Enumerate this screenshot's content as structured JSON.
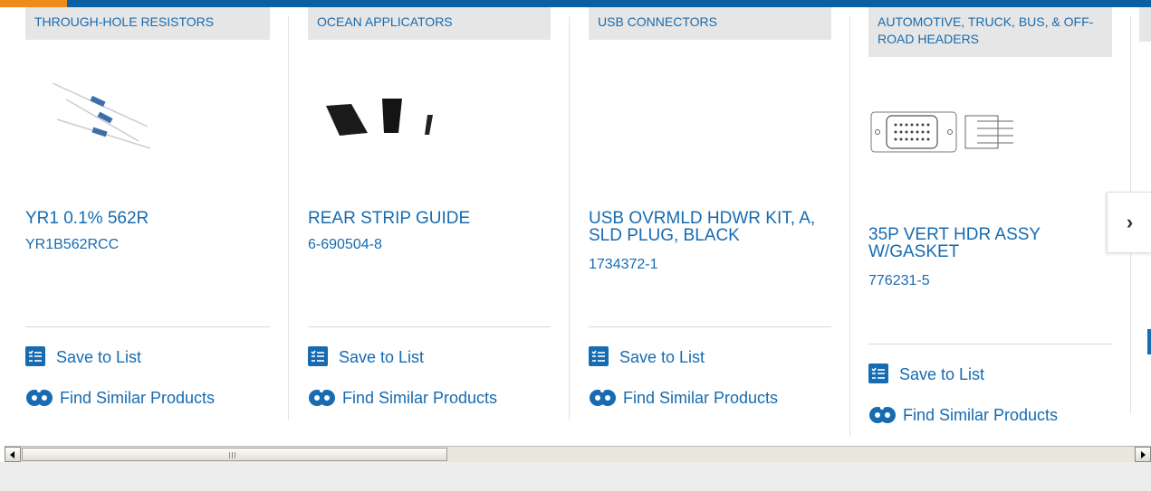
{
  "colors": {
    "accent": "#ef8a1c",
    "brand": "#0a60a3",
    "link": "#176bb0"
  },
  "nav": {
    "next_icon": "›"
  },
  "cards": [
    {
      "category": "THROUGH-HOLE RESISTORS",
      "title": "YR1 0.1% 562R",
      "part": "YR1B562RCC",
      "save": "Save to List",
      "similar": "Find Similar Products",
      "image": "resistor-image"
    },
    {
      "category": "OCEAN APPLICATORS",
      "title": "REAR STRIP GUIDE",
      "part": "6-690504-8",
      "save": "Save to List",
      "similar": "Find Similar Products",
      "image": "strip-guide-image"
    },
    {
      "category": "USB CONNECTORS",
      "title": "USB OVRMLD HDWR KIT, A, SLD PLUG, BLACK",
      "part": "1734372-1",
      "save": "Save to List",
      "similar": "Find Similar Products",
      "image": ""
    },
    {
      "category": "AUTOMOTIVE, TRUCK, BUS, & OFF-ROAD HEADERS",
      "title": "35P VERT HDR ASSY W/GASKET",
      "part": "776231-5",
      "save": "Save to List",
      "similar": "Find Similar Products",
      "image": "header-assembly-image"
    }
  ]
}
